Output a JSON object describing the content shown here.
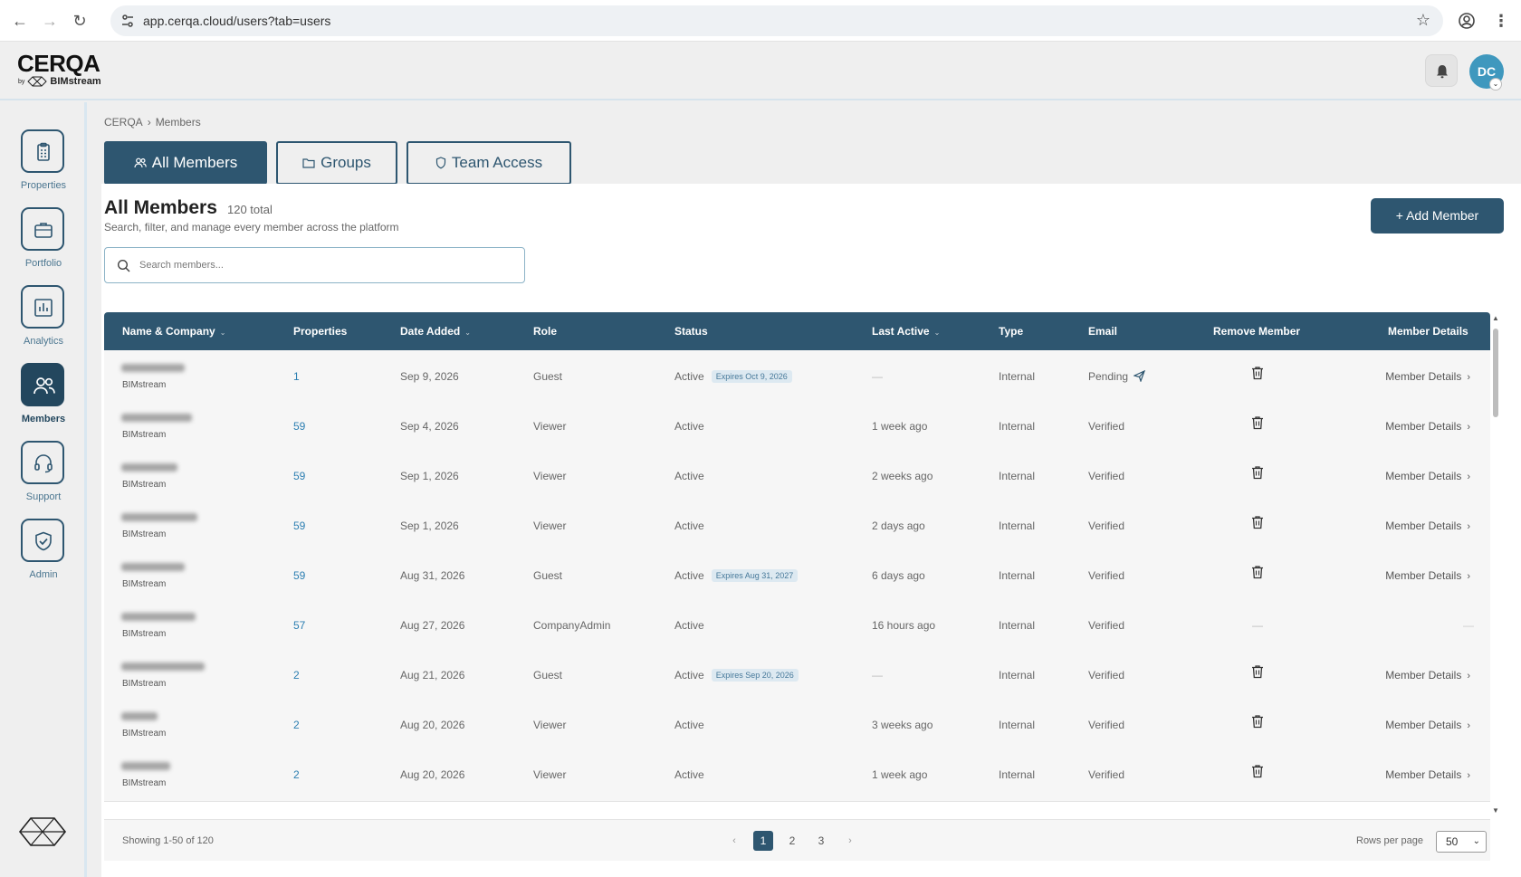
{
  "browser": {
    "url": "app.cerqa.cloud/users?tab=users"
  },
  "header": {
    "logo": "CERQA",
    "logo_by": "by",
    "logo_brand": "BIMstream",
    "avatar_initials": "DC"
  },
  "sidebar": {
    "items": [
      {
        "label": "Properties",
        "icon": "clipboard-icon"
      },
      {
        "label": "Portfolio",
        "icon": "briefcase-icon"
      },
      {
        "label": "Analytics",
        "icon": "bar-chart-icon"
      },
      {
        "label": "Members",
        "icon": "users-icon",
        "active": true
      },
      {
        "label": "Support",
        "icon": "headset-icon"
      },
      {
        "label": "Admin",
        "icon": "shield-check-icon"
      }
    ]
  },
  "breadcrumb": [
    "CERQA",
    "Members"
  ],
  "tabs": [
    {
      "label": "All Members",
      "icon": "users-icon",
      "active": true
    },
    {
      "label": "Groups",
      "icon": "folder-icon"
    },
    {
      "label": "Team Access",
      "icon": "shield-icon"
    }
  ],
  "page": {
    "title": "All Members",
    "total": "120 total",
    "subtitle": "Search, filter, and manage every member across the platform",
    "add_button": "+ Add Member"
  },
  "search": {
    "placeholder": "Search members...",
    "value": ""
  },
  "table": {
    "columns": [
      "Name & Company",
      "Properties",
      "Date Added",
      "Role",
      "Status",
      "Last Active",
      "Type",
      "Email",
      "Remove Member",
      "Member Details"
    ],
    "rows": [
      {
        "company": "BIMstream",
        "properties": "1",
        "date_added": "Sep 9, 2026",
        "role": "Guest",
        "status": "Active",
        "expires": "Expires Oct 9, 2026",
        "last_active": "—",
        "type": "Internal",
        "email": "Pending",
        "removable": true,
        "details": "Member Details"
      },
      {
        "company": "BIMstream",
        "properties": "59",
        "date_added": "Sep 4, 2026",
        "role": "Viewer",
        "status": "Active",
        "expires": "",
        "last_active": "1 week ago",
        "type": "Internal",
        "email": "Verified",
        "removable": true,
        "details": "Member Details"
      },
      {
        "company": "BIMstream",
        "properties": "59",
        "date_added": "Sep 1, 2026",
        "role": "Viewer",
        "status": "Active",
        "expires": "",
        "last_active": "2 weeks ago",
        "type": "Internal",
        "email": "Verified",
        "removable": true,
        "details": "Member Details"
      },
      {
        "company": "BIMstream",
        "properties": "59",
        "date_added": "Sep 1, 2026",
        "role": "Viewer",
        "status": "Active",
        "expires": "",
        "last_active": "2 days ago",
        "type": "Internal",
        "email": "Verified",
        "removable": true,
        "details": "Member Details"
      },
      {
        "company": "BIMstream",
        "properties": "59",
        "date_added": "Aug 31, 2026",
        "role": "Guest",
        "status": "Active",
        "expires": "Expires Aug 31, 2027",
        "last_active": "6 days ago",
        "type": "Internal",
        "email": "Verified",
        "removable": true,
        "details": "Member Details"
      },
      {
        "company": "BIMstream",
        "properties": "57",
        "date_added": "Aug 27, 2026",
        "role": "CompanyAdmin",
        "status": "Active",
        "expires": "",
        "last_active": "16 hours ago",
        "type": "Internal",
        "email": "Verified",
        "removable": false,
        "details": "—"
      },
      {
        "company": "BIMstream",
        "properties": "2",
        "date_added": "Aug 21, 2026",
        "role": "Guest",
        "status": "Active",
        "expires": "Expires Sep 20, 2026",
        "last_active": "—",
        "type": "Internal",
        "email": "Verified",
        "removable": true,
        "details": "Member Details"
      },
      {
        "company": "BIMstream",
        "properties": "2",
        "date_added": "Aug 20, 2026",
        "role": "Viewer",
        "status": "Active",
        "expires": "",
        "last_active": "3 weeks ago",
        "type": "Internal",
        "email": "Verified",
        "removable": true,
        "details": "Member Details"
      },
      {
        "company": "BIMstream",
        "properties": "2",
        "date_added": "Aug 20, 2026",
        "role": "Viewer",
        "status": "Active",
        "expires": "",
        "last_active": "1 week ago",
        "type": "Internal",
        "email": "Verified",
        "removable": true,
        "details": "Member Details"
      }
    ],
    "remove_dash": "—"
  },
  "footer": {
    "showing": "Showing 1-50 of 120",
    "pages": [
      "1",
      "2",
      "3"
    ],
    "current_page": "1",
    "prev": "‹",
    "next": "›",
    "rows_per_page_label": "Rows per page",
    "rows_per_page": "50"
  },
  "colors": {
    "primary": "#2e5670",
    "accent": "#3f98be",
    "link": "#2d7fb2"
  }
}
